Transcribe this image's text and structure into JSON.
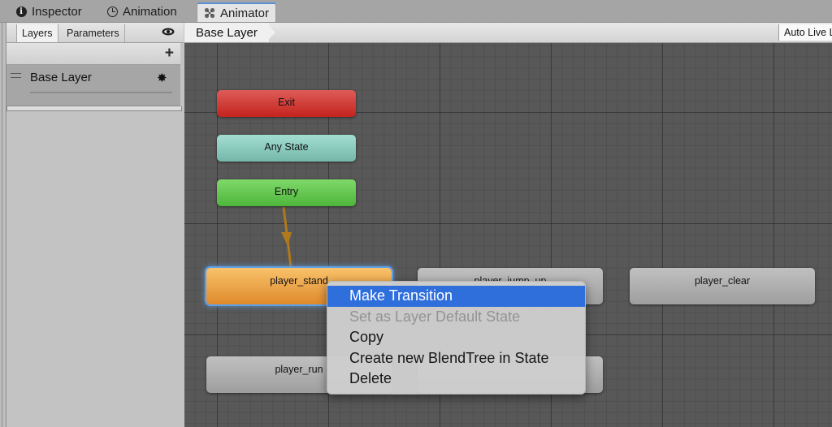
{
  "window_tabs": [
    {
      "label": "Inspector",
      "icon": "info-icon",
      "active": false
    },
    {
      "label": "Animation",
      "icon": "clock-icon",
      "active": false
    },
    {
      "label": "Animator",
      "icon": "animator-icon",
      "active": true
    }
  ],
  "left_panel": {
    "tabs": [
      {
        "label": "Layers",
        "selected": true
      },
      {
        "label": "Parameters",
        "selected": false
      }
    ],
    "eye_icon": "eye-icon",
    "add_icon": "+",
    "layers": [
      {
        "name": "Base Layer",
        "settings_icon": "✸"
      }
    ]
  },
  "breadcrumb": {
    "items": [
      "Base Layer"
    ],
    "auto_live_label": "Auto Live Link"
  },
  "graph": {
    "nodes": [
      {
        "id": "exit",
        "label": "Exit",
        "type": "exit",
        "color": "#d2403b"
      },
      {
        "id": "any",
        "label": "Any State",
        "type": "any",
        "color": "#8ccbbe"
      },
      {
        "id": "entry",
        "label": "Entry",
        "type": "entry",
        "color": "#63c84f"
      },
      {
        "id": "player_stand",
        "label": "player_stand",
        "type": "default",
        "color": "#eda64a"
      },
      {
        "id": "player_jump_up",
        "label": "player_jump_up",
        "type": "state",
        "color": "#afafaf"
      },
      {
        "id": "player_clear",
        "label": "player_clear",
        "type": "state",
        "color": "#afafaf"
      },
      {
        "id": "player_run",
        "label": "player_run",
        "type": "state",
        "color": "#afafaf"
      },
      {
        "id": "hidden_state",
        "label": "",
        "type": "state",
        "color": "#afafaf"
      }
    ],
    "transitions": [
      {
        "from": "entry",
        "to": "player_stand",
        "color": "#b07a1c"
      }
    ]
  },
  "context_menu": {
    "items": [
      {
        "label": "Make Transition",
        "state": "highlighted"
      },
      {
        "label": "Set as Layer Default State",
        "state": "disabled"
      },
      {
        "label": "Copy",
        "state": "enabled"
      },
      {
        "label": "Create new BlendTree in State",
        "state": "enabled"
      },
      {
        "label": "Delete",
        "state": "enabled"
      }
    ],
    "highlight_color": "#2f6fdc"
  }
}
